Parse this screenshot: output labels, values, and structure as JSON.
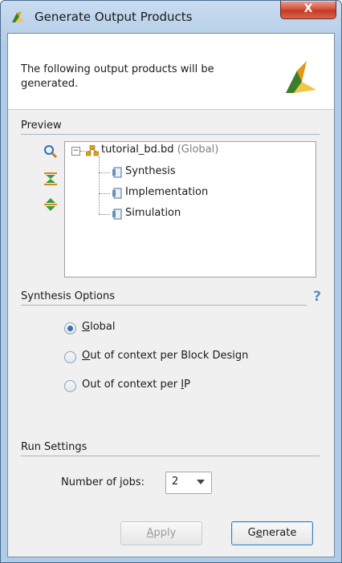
{
  "window": {
    "title": "Generate Output Products",
    "close_label": "X"
  },
  "header": {
    "message": "The following output products will be generated."
  },
  "preview": {
    "label": "Preview",
    "tree": {
      "root_name": "tutorial_bd.bd",
      "root_suffix": "(Global)",
      "children": [
        "Synthesis",
        "Implementation",
        "Simulation"
      ]
    }
  },
  "synthesis_options": {
    "label": "Synthesis Options",
    "help": "?",
    "options": [
      {
        "pre": "",
        "key": "G",
        "post": "lobal",
        "selected": true
      },
      {
        "pre": "",
        "key": "O",
        "post": "ut of context per Block Design",
        "selected": false
      },
      {
        "pre": "Out of context per ",
        "key": "I",
        "post": "P",
        "selected": false
      }
    ]
  },
  "run_settings": {
    "label": "Run Settings",
    "jobs_label_pre": "Number of ",
    "jobs_label_key": "j",
    "jobs_label_post": "obs:",
    "jobs_value": "2"
  },
  "buttons": {
    "apply": {
      "pre": "",
      "key": "A",
      "post": "pply"
    },
    "generate": {
      "pre": "G",
      "key": "e",
      "post": "nerate"
    }
  }
}
